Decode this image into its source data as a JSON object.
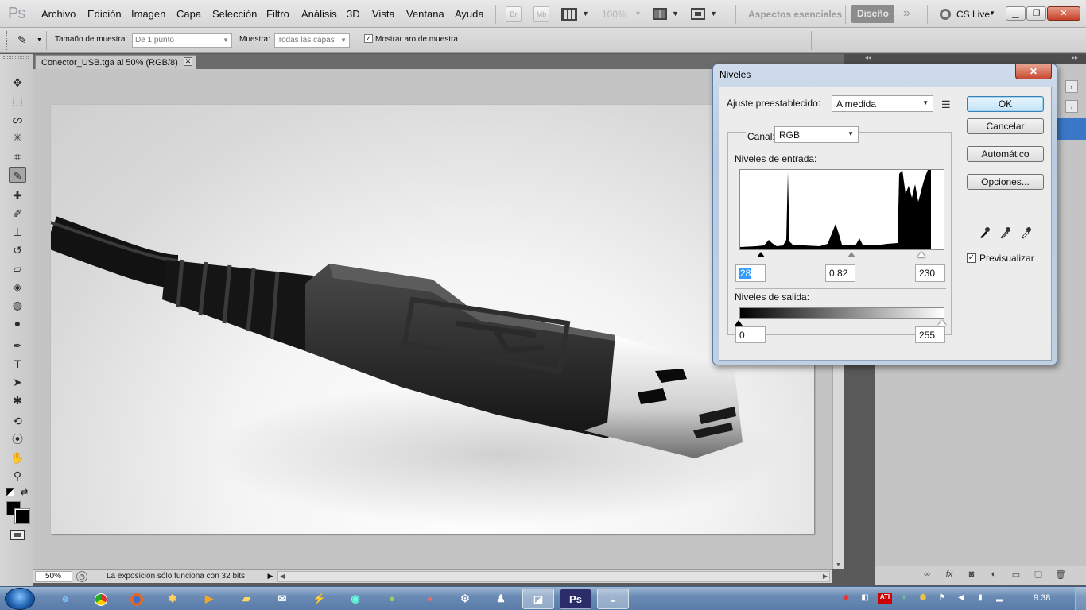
{
  "app": {
    "logo": "Ps"
  },
  "menu": {
    "items": [
      "Archivo",
      "Edición",
      "Imagen",
      "Capa",
      "Selección",
      "Filtro",
      "Análisis",
      "3D",
      "Vista",
      "Ventana",
      "Ayuda"
    ],
    "bridge": "Br",
    "minibridge": "Mb",
    "zoom": "100%",
    "workspace_essentials": "Aspectos esenciales",
    "workspace_active": "Diseño",
    "cs_live": "CS Live"
  },
  "options": {
    "sample_size_label": "Tamaño de muestra:",
    "sample_size_value": "De 1 punto",
    "sample_label": "Muestra:",
    "sample_value": "Todas las capas",
    "show_ring_checked": true,
    "show_ring_label": "Mostrar aro de muestra"
  },
  "document": {
    "tab_title": "Conector_USB.tga al 50% (RGB/8)",
    "zoom": "50%",
    "status": "La exposición sólo funciona con 32 bits"
  },
  "dialog": {
    "title": "Niveles",
    "preset_label": "Ajuste preestablecido:",
    "preset_value": "A medida",
    "channel_label": "Canal:",
    "channel_value": "RGB",
    "input_levels_label": "Niveles de entrada:",
    "input_black": "28",
    "input_gamma": "0,82",
    "input_white": "230",
    "output_levels_label": "Niveles de salida:",
    "output_black": "0",
    "output_white": "255",
    "btn_ok": "OK",
    "btn_cancel": "Cancelar",
    "btn_auto": "Automático",
    "btn_options": "Opciones...",
    "preview_checked": true,
    "preview_label": "Previsualizar"
  },
  "taskbar": {
    "clock": "9:38",
    "active_app": "Ps"
  },
  "colors": {
    "dialog_frame": "#bfd0e3",
    "ok_button": "#c0e2f6",
    "taskbar": "#6a8bb4",
    "workspace_active": "#8c8c8c"
  }
}
